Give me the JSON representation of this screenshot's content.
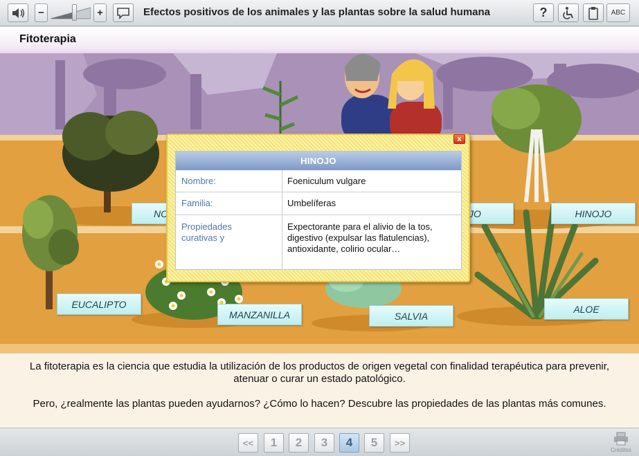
{
  "toolbar": {
    "title": "Efectos positivos de los animales y las plantas sobre la salud humana",
    "volume_minus": "−",
    "volume_plus": "+",
    "help": "?",
    "abc": "ABC"
  },
  "section": {
    "title": "Fitoterapia"
  },
  "plant_labels": {
    "eucalipto": "EUCALIPTO",
    "manzanilla": "MANZANILLA",
    "salvia": "SALVIA",
    "aloe": "ALOE",
    "hinojo": "HINOJO",
    "partial_left": "NO",
    "partial_right": "JO"
  },
  "popup": {
    "close": "x",
    "header": "HINOJO",
    "rows": [
      {
        "key": "Nombre:",
        "value": "Foeniculum vulgare"
      },
      {
        "key": "Familia:",
        "value": "Umbelíferas"
      },
      {
        "key": "Propiedades curativas y",
        "value": "Expectorante para el alivio de la tos, digestivo (expulsar las flatulencias), antioxidante, colirio ocular…"
      }
    ]
  },
  "description": {
    "p1": "La fitoterapia es la ciencia que estudia la utilización de los productos de origen vegetal con finalidad terapéutica para prevenir, atenuar o curar un estado patológico.",
    "p2": "Pero, ¿realmente las plantas pueden ayudarnos? ¿Cómo lo hacen? Descubre las propiedades de las plantas más comunes."
  },
  "pagination": {
    "first": "<<",
    "pages": [
      "1",
      "2",
      "3",
      "4",
      "5"
    ],
    "current": "4",
    "last": ">>"
  },
  "footer": {
    "credits": "Créditos"
  },
  "colors": {
    "sky": "#a991b8",
    "ground": "#e2a040",
    "popup_header": "#7f99c6",
    "label_bg": "#cdf2f3"
  }
}
